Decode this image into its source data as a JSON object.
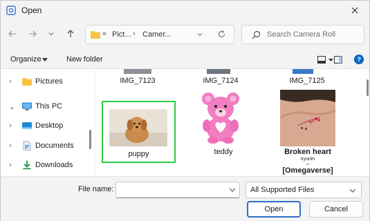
{
  "window": {
    "title": "Open"
  },
  "nav": {
    "breadcrumb": [
      "Pict...",
      "Camer..."
    ],
    "overflow": "«",
    "separator": "›",
    "search_placeholder": "Search Camera Roll"
  },
  "toolbar": {
    "organize": "Organize",
    "new_folder": "New folder"
  },
  "sidebar": {
    "items": [
      {
        "label": "Pictures",
        "icon": "folder-icon"
      },
      {
        "label": "This PC",
        "icon": "computer-icon"
      },
      {
        "label": "Desktop",
        "icon": "desktop-icon"
      },
      {
        "label": "Documents",
        "icon": "documents-icon"
      },
      {
        "label": "Downloads",
        "icon": "download-icon"
      }
    ]
  },
  "files": {
    "prev_row": [
      "IMG_7123",
      "IMG_7124",
      "IMG_7125"
    ],
    "tiles": [
      {
        "label": "puppy",
        "selected": true
      },
      {
        "label": "teddy",
        "selected": false
      },
      {
        "label": "Broken heart",
        "sublabel": "nyunin",
        "dash": "–",
        "label2": "[Omegaverse]",
        "selected": false
      }
    ]
  },
  "bottom": {
    "file_name_label": "File name:",
    "file_name_value": "",
    "file_type": "All Supported Files",
    "open": "Open",
    "cancel": "Cancel"
  },
  "colors": {
    "accent": "#0067c0",
    "selection": "#2ecc40",
    "folder": "#f4c542"
  }
}
